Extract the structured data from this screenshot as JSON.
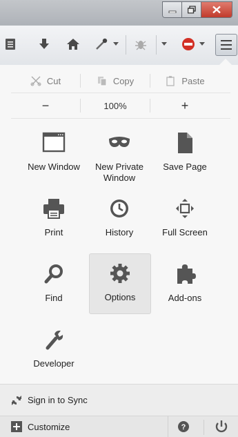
{
  "edit": {
    "cut": "Cut",
    "copy": "Copy",
    "paste": "Paste"
  },
  "zoom": {
    "out": "−",
    "level": "100%",
    "in": "+"
  },
  "grid": [
    {
      "label": "New Window",
      "icon": "new-window-icon"
    },
    {
      "label": "New Private Window",
      "icon": "mask-icon"
    },
    {
      "label": "Save Page",
      "icon": "save-page-icon"
    },
    {
      "label": "Print",
      "icon": "printer-icon"
    },
    {
      "label": "History",
      "icon": "clock-icon"
    },
    {
      "label": "Full Screen",
      "icon": "fullscreen-icon"
    },
    {
      "label": "Find",
      "icon": "magnifier-icon"
    },
    {
      "label": "Options",
      "icon": "gear-icon"
    },
    {
      "label": "Add-ons",
      "icon": "puzzle-icon"
    },
    {
      "label": "Developer",
      "icon": "wrench-icon"
    }
  ],
  "footer": {
    "sync": "Sign in to Sync",
    "customize": "Customize"
  },
  "colors": {
    "accent_red": "#c13b2b",
    "adblock": "#d23025"
  }
}
